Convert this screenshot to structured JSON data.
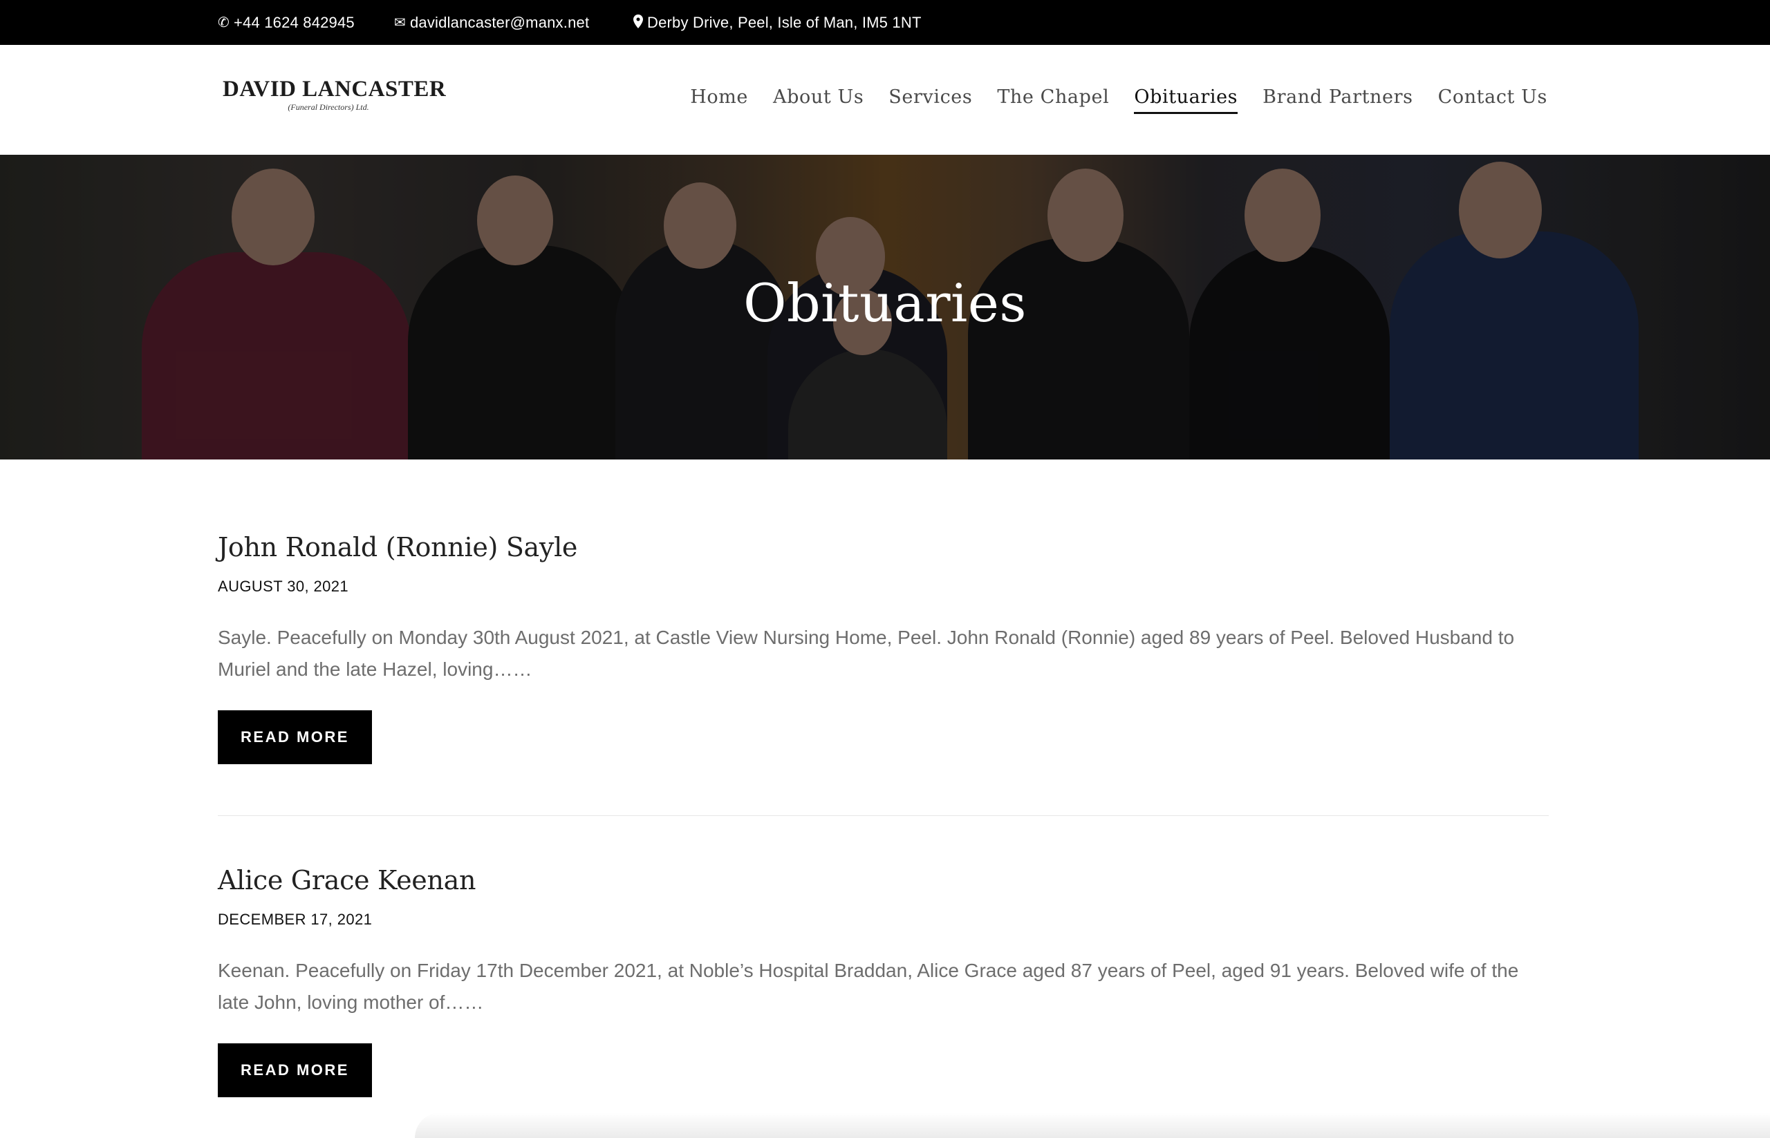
{
  "topbar": {
    "phone": "+44 1624 842945",
    "email": "davidlancaster@manx.net",
    "address": "Derby Drive, Peel, Isle of Man, IM5 1NT"
  },
  "logo": {
    "main": "DAVID LANCASTER",
    "sub": "(Funeral Directors) Ltd."
  },
  "nav": {
    "items": [
      "Home",
      "About Us",
      "Services",
      "The Chapel",
      "Obituaries",
      "Brand Partners",
      "Contact Us"
    ],
    "active": "Obituaries"
  },
  "hero": {
    "title": "Obituaries"
  },
  "posts": [
    {
      "title": "John Ronald (Ronnie) Sayle",
      "date": "AUGUST 30, 2021",
      "excerpt": "Sayle. Peacefully on Monday 30th August 2021, at Castle View Nursing Home, Peel. John Ronald (Ronnie) aged 89 years of Peel. Beloved Husband to Muriel and the late Hazel, loving……",
      "button": "READ MORE"
    },
    {
      "title": "Alice Grace Keenan",
      "date": "DECEMBER 17, 2021",
      "excerpt": "Keenan. Peacefully on Friday 17th December 2021, at Noble’s Hospital Braddan, Alice Grace aged 87 years of Peel, aged 91 years. Beloved wife of the late John, loving mother of……",
      "button": "READ MORE"
    }
  ]
}
